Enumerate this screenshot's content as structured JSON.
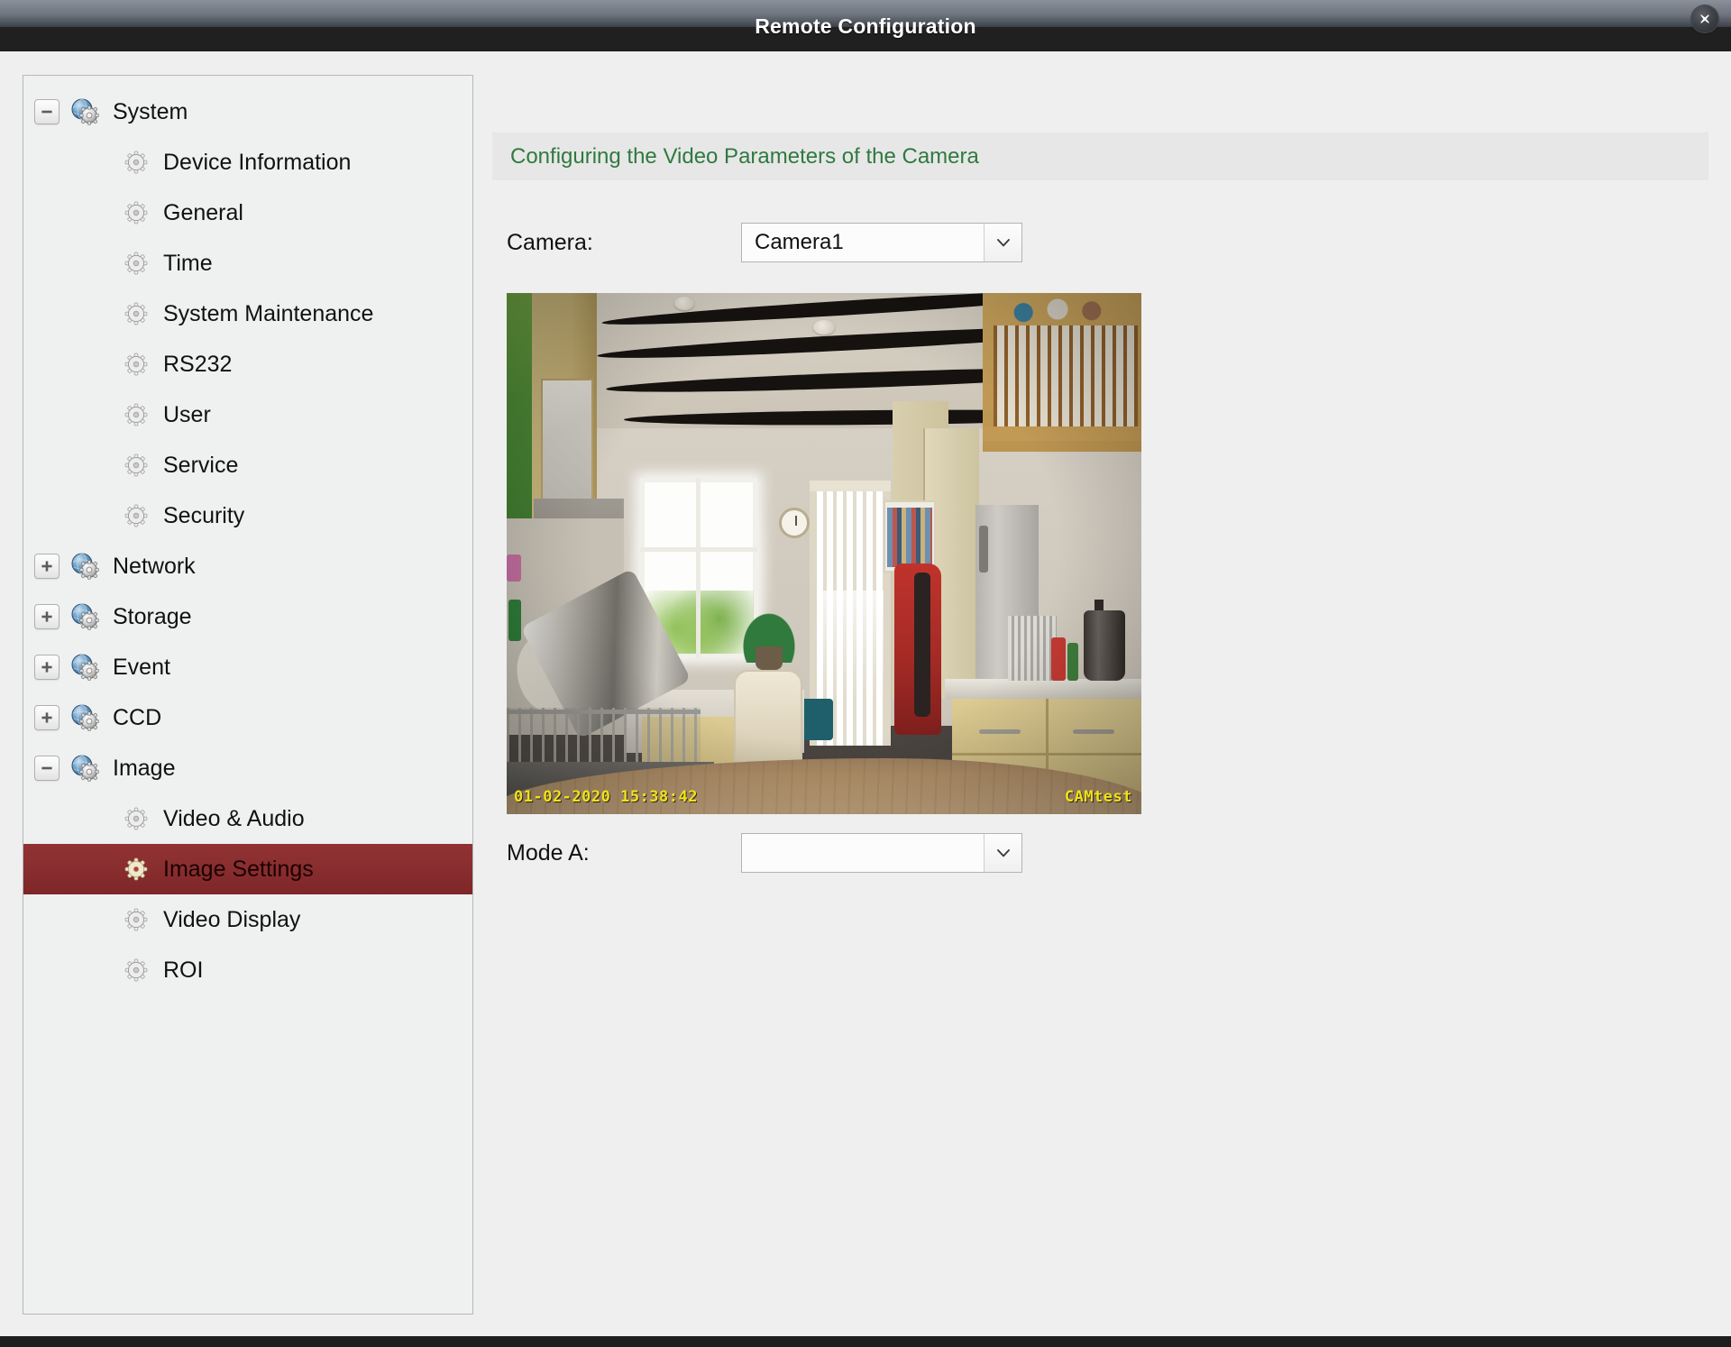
{
  "window": {
    "title": "Remote Configuration",
    "close_icon": "close-icon"
  },
  "sidebar": {
    "tree": [
      {
        "label": "System",
        "level": 0,
        "toggle": "minus",
        "icon": "globe-gear-icon",
        "selected": false
      },
      {
        "label": "Device Information",
        "level": 1,
        "toggle": "none",
        "icon": "gear-icon",
        "selected": false
      },
      {
        "label": "General",
        "level": 1,
        "toggle": "none",
        "icon": "gear-icon",
        "selected": false
      },
      {
        "label": "Time",
        "level": 1,
        "toggle": "none",
        "icon": "gear-icon",
        "selected": false
      },
      {
        "label": "System Maintenance",
        "level": 1,
        "toggle": "none",
        "icon": "gear-icon",
        "selected": false
      },
      {
        "label": "RS232",
        "level": 1,
        "toggle": "none",
        "icon": "gear-icon",
        "selected": false
      },
      {
        "label": "User",
        "level": 1,
        "toggle": "none",
        "icon": "gear-icon",
        "selected": false
      },
      {
        "label": "Service",
        "level": 1,
        "toggle": "none",
        "icon": "gear-icon",
        "selected": false
      },
      {
        "label": "Security",
        "level": 1,
        "toggle": "none",
        "icon": "gear-icon",
        "selected": false
      },
      {
        "label": "Network",
        "level": 0,
        "toggle": "plus",
        "icon": "globe-gear-icon",
        "selected": false
      },
      {
        "label": "Storage",
        "level": 0,
        "toggle": "plus",
        "icon": "globe-gear-icon",
        "selected": false
      },
      {
        "label": "Event",
        "level": 0,
        "toggle": "plus",
        "icon": "globe-gear-icon",
        "selected": false
      },
      {
        "label": "CCD",
        "level": 0,
        "toggle": "plus",
        "icon": "globe-gear-icon",
        "selected": false
      },
      {
        "label": "Image",
        "level": 0,
        "toggle": "minus",
        "icon": "globe-gear-icon",
        "selected": false
      },
      {
        "label": "Video & Audio",
        "level": 1,
        "toggle": "none",
        "icon": "gear-icon",
        "selected": false
      },
      {
        "label": "Image Settings",
        "level": 1,
        "toggle": "none",
        "icon": "gear-icon",
        "selected": true
      },
      {
        "label": "Video Display",
        "level": 1,
        "toggle": "none",
        "icon": "gear-icon",
        "selected": false
      },
      {
        "label": "ROI",
        "level": 1,
        "toggle": "none",
        "icon": "gear-icon",
        "selected": false
      }
    ]
  },
  "main": {
    "header": "Configuring the Video Parameters of the Camera",
    "header_color": "#2f7a3f",
    "camera_field": {
      "label": "Camera:",
      "value": "Camera1",
      "arrow_icon": "chevron-down-icon"
    },
    "mode_field": {
      "label": "Mode A:",
      "value": "",
      "arrow_icon": "chevron-down-icon"
    },
    "preview": {
      "osd_timestamp": "01-02-2020 15:38:42",
      "osd_camera_name": "CAMtest"
    }
  },
  "theme": {
    "selection_color": "#8a2e30",
    "panel_background": "#eff0f0",
    "page_background": "#efefef",
    "titlebar_background": "#1f1f1f"
  }
}
